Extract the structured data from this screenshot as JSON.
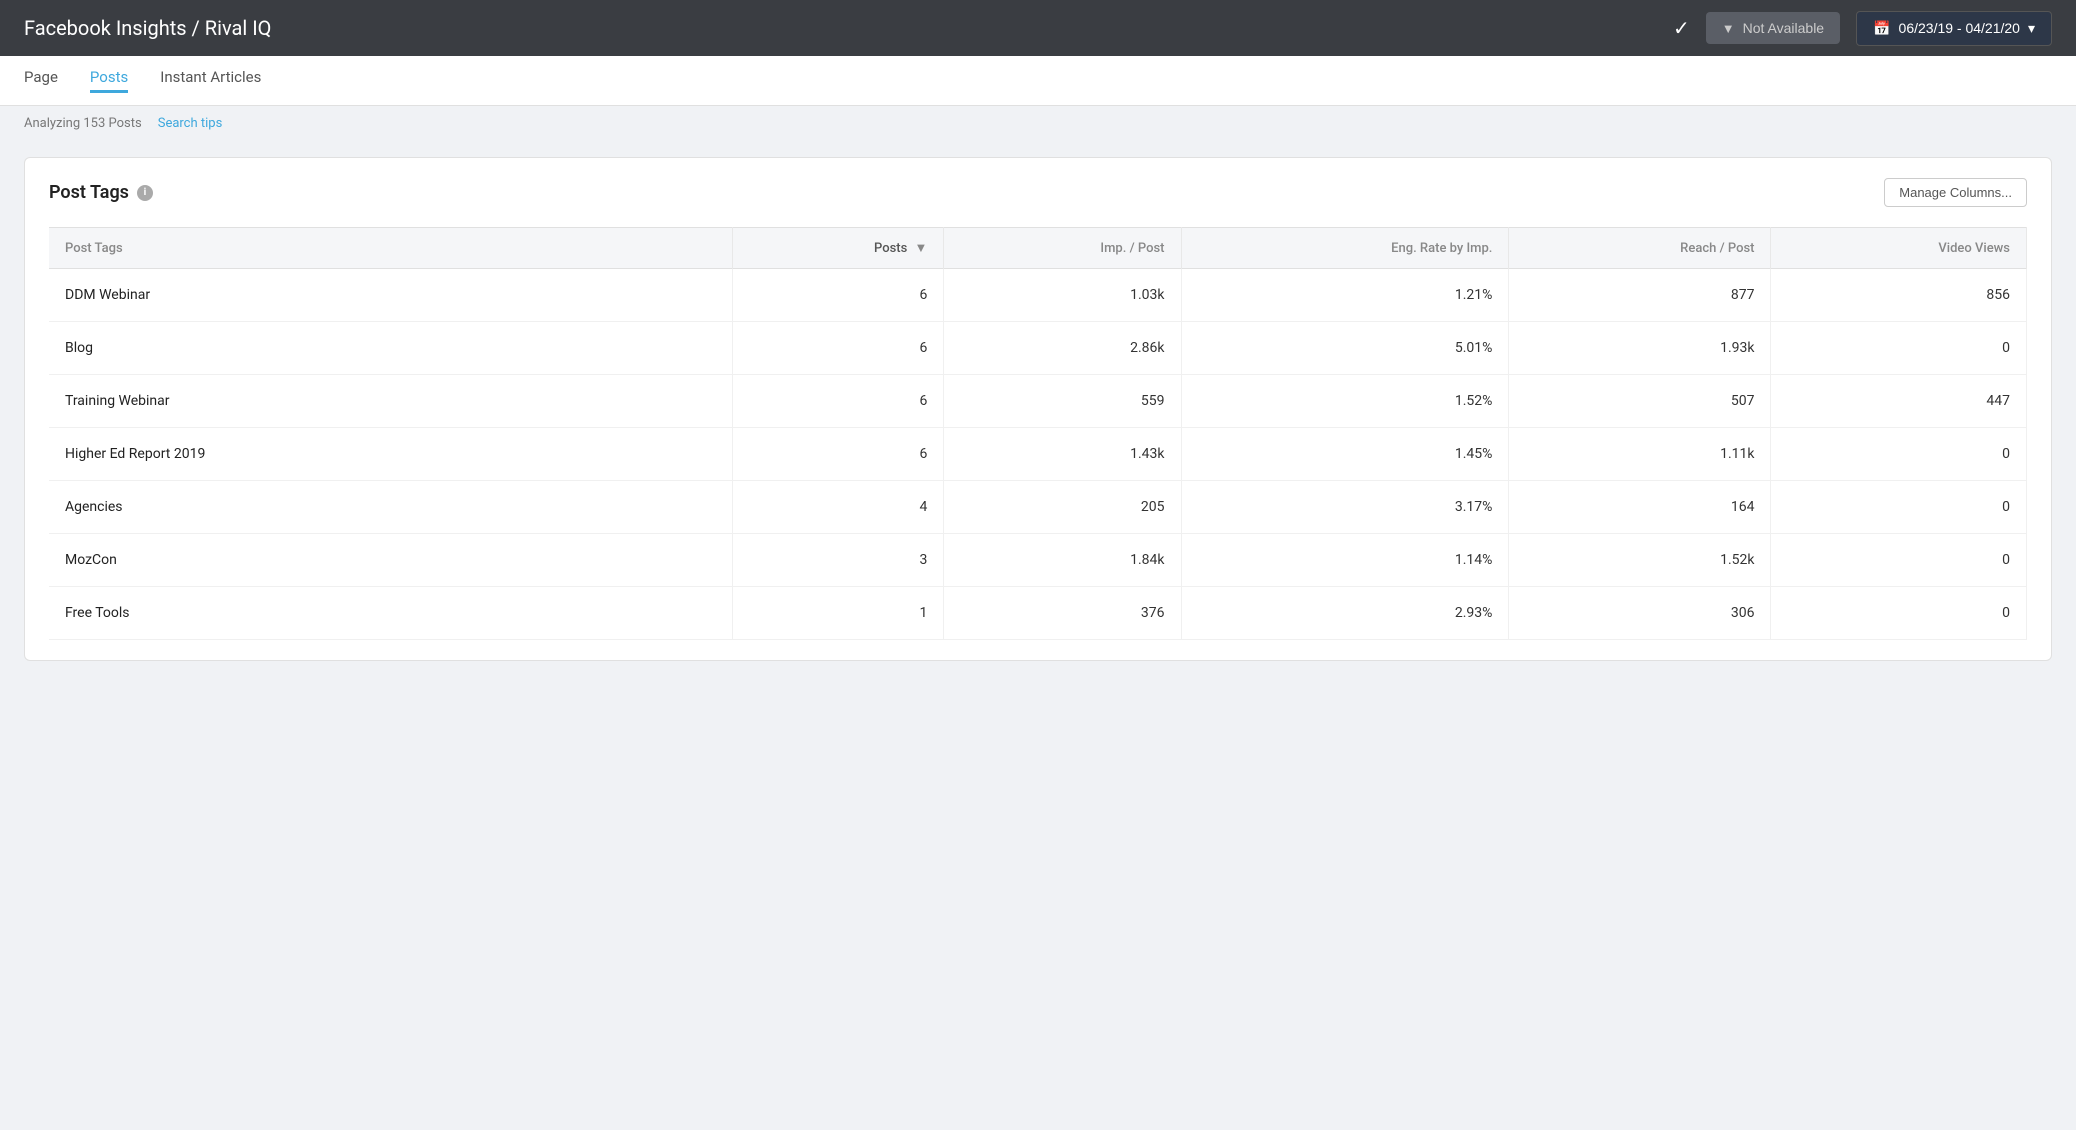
{
  "header": {
    "title": "Facebook Insights / Rival IQ",
    "check_icon": "✓",
    "filter_label": "Not Available",
    "date_range": "06/23/19 - 04/21/20"
  },
  "tabs": [
    {
      "id": "page",
      "label": "Page",
      "active": false
    },
    {
      "id": "posts",
      "label": "Posts",
      "active": true
    },
    {
      "id": "instant-articles",
      "label": "Instant Articles",
      "active": false
    }
  ],
  "subbar": {
    "analyzing_text": "Analyzing 153 Posts",
    "search_tips_label": "Search tips"
  },
  "card": {
    "title": "Post Tags",
    "manage_columns_label": "Manage Columns...",
    "table": {
      "columns": [
        {
          "id": "post-tags",
          "label": "Post Tags",
          "sortable": false,
          "align": "left"
        },
        {
          "id": "posts",
          "label": "Posts",
          "sortable": true,
          "align": "right"
        },
        {
          "id": "imp-per-post",
          "label": "Imp. / Post",
          "sortable": false,
          "align": "right"
        },
        {
          "id": "eng-rate-by-imp",
          "label": "Eng. Rate by Imp.",
          "sortable": false,
          "align": "right"
        },
        {
          "id": "reach-per-post",
          "label": "Reach / Post",
          "sortable": false,
          "align": "right"
        },
        {
          "id": "video-views",
          "label": "Video Views",
          "sortable": false,
          "align": "right"
        }
      ],
      "rows": [
        {
          "tag": "DDM Webinar",
          "posts": "6",
          "imp_per_post": "1.03k",
          "eng_rate": "1.21%",
          "reach": "877",
          "video_views": "856"
        },
        {
          "tag": "Blog",
          "posts": "6",
          "imp_per_post": "2.86k",
          "eng_rate": "5.01%",
          "reach": "1.93k",
          "video_views": "0"
        },
        {
          "tag": "Training Webinar",
          "posts": "6",
          "imp_per_post": "559",
          "eng_rate": "1.52%",
          "reach": "507",
          "video_views": "447"
        },
        {
          "tag": "Higher Ed Report 2019",
          "posts": "6",
          "imp_per_post": "1.43k",
          "eng_rate": "1.45%",
          "reach": "1.11k",
          "video_views": "0"
        },
        {
          "tag": "Agencies",
          "posts": "4",
          "imp_per_post": "205",
          "eng_rate": "3.17%",
          "reach": "164",
          "video_views": "0"
        },
        {
          "tag": "MozCon",
          "posts": "3",
          "imp_per_post": "1.84k",
          "eng_rate": "1.14%",
          "reach": "1.52k",
          "video_views": "0"
        },
        {
          "tag": "Free Tools",
          "posts": "1",
          "imp_per_post": "376",
          "eng_rate": "2.93%",
          "reach": "306",
          "video_views": "0"
        }
      ]
    }
  }
}
